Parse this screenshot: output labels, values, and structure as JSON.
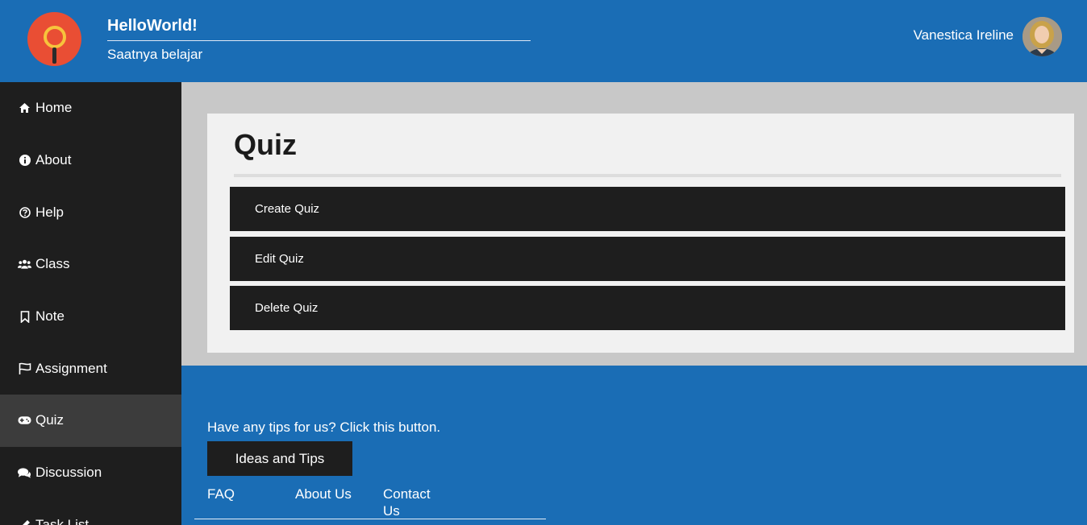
{
  "header": {
    "brand_title": "HelloWorld!",
    "brand_subtitle": "Saatnya belajar",
    "user_name": "Vanestica Ireline"
  },
  "sidebar": {
    "items": [
      {
        "label": "Home",
        "icon": "home-icon"
      },
      {
        "label": "About",
        "icon": "info-icon"
      },
      {
        "label": "Help",
        "icon": "question-circle-icon"
      },
      {
        "label": "Class",
        "icon": "users-icon"
      },
      {
        "label": "Note",
        "icon": "bookmark-icon"
      },
      {
        "label": "Assignment",
        "icon": "flag-icon"
      },
      {
        "label": "Quiz",
        "icon": "gamepad-icon",
        "active": true
      },
      {
        "label": "Discussion",
        "icon": "comments-icon"
      },
      {
        "label": "Task List",
        "icon": "pencil-icon"
      }
    ]
  },
  "main": {
    "title": "Quiz",
    "actions": [
      "Create Quiz",
      "Edit Quiz",
      "Delete Quiz"
    ]
  },
  "footer": {
    "tips_text": "Have any tips for us? Click this button.",
    "tips_button": "Ideas and Tips",
    "links": [
      "FAQ",
      "About Us",
      "Contact Us"
    ]
  },
  "colors": {
    "primary_blue": "#1a6db5",
    "sidebar_dark": "#1e1e1e",
    "sidebar_active": "#3c3c3c",
    "logo_red": "#e94e34",
    "logo_yellow": "#f7c33c"
  }
}
